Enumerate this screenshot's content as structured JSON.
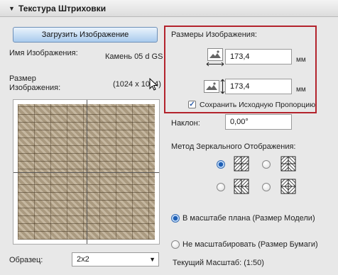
{
  "header": {
    "title": "Текстура Штриховки"
  },
  "buttons": {
    "load_image": "Загрузить Изображение"
  },
  "image_info": {
    "name_label": "Имя Изображения:",
    "name_value": "Камень 05 d GS",
    "size_label_line1": "Размер",
    "size_label_line2": "Изображения:",
    "size_value": "(1024 x 1024)"
  },
  "image_sizes": {
    "title": "Размеры Изображения:",
    "width_value": "173,4",
    "height_value": "173,4",
    "unit": "мм",
    "keep_ratio_label": "Сохранить Исходную Пропорцию",
    "keep_ratio_checked": true
  },
  "rotation": {
    "label": "Наклон:",
    "value": "0,00°"
  },
  "mirror": {
    "label": "Метод Зеркального Отображения:"
  },
  "scale": {
    "option_model": "В масштабе плана (Размер Модели)",
    "option_paper": "Не масштабировать (Размер Бумаги)",
    "current_label": "Текущий Масштаб: (1:50)"
  },
  "sample": {
    "label": "Образец:",
    "value": "2x2"
  }
}
